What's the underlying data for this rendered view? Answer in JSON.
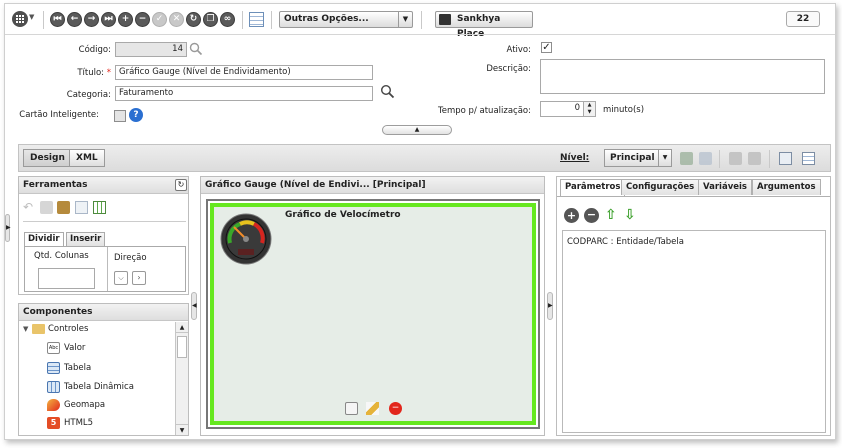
{
  "toolbar": {
    "more_options_label": "Outras Opções...",
    "place_label": "Sankhya Place",
    "notifications_count": "22"
  },
  "form": {
    "codigo_label": "Código:",
    "codigo_value": "14",
    "titulo_label": "Título:",
    "titulo_value": "Gráfico Gauge (Nível de Endividamento)",
    "categoria_label": "Categoria:",
    "categoria_value": "Faturamento",
    "cartao_label": "Cartão Inteligente:",
    "ativo_label": "Ativo:",
    "ativo_checked": true,
    "descricao_label": "Descrição:",
    "tempo_label": "Tempo p/ atualização:",
    "tempo_value": "0",
    "tempo_unit": "minuto(s)"
  },
  "modebar": {
    "design_label": "Design",
    "xml_label": "XML",
    "nivel_label": "Nível:",
    "nivel_value": "Principal"
  },
  "ferramentas": {
    "title": "Ferramentas",
    "tab_dividir": "Dividir",
    "tab_inserir": "Inserir",
    "qtd_colunas_label": "Qtd. Colunas",
    "direcao_label": "Direção"
  },
  "componentes": {
    "title": "Componentes",
    "group": "Controles",
    "items": [
      "Valor",
      "Tabela",
      "Tabela Dinâmica",
      "Geomapa",
      "HTML5"
    ]
  },
  "canvas": {
    "title": "Gráfico Gauge (Nível de Endivi...  [Principal]",
    "chart_title": "Gráfico de Velocímetro"
  },
  "right_panel": {
    "tabs": [
      "Parâmetros",
      "Configurações",
      "Variáveis",
      "Argumentos"
    ],
    "param_item": "CODPARC : Entidade/Tabela"
  },
  "colors": {
    "accent_green": "#66e81f",
    "required_red": "#e2261c"
  }
}
